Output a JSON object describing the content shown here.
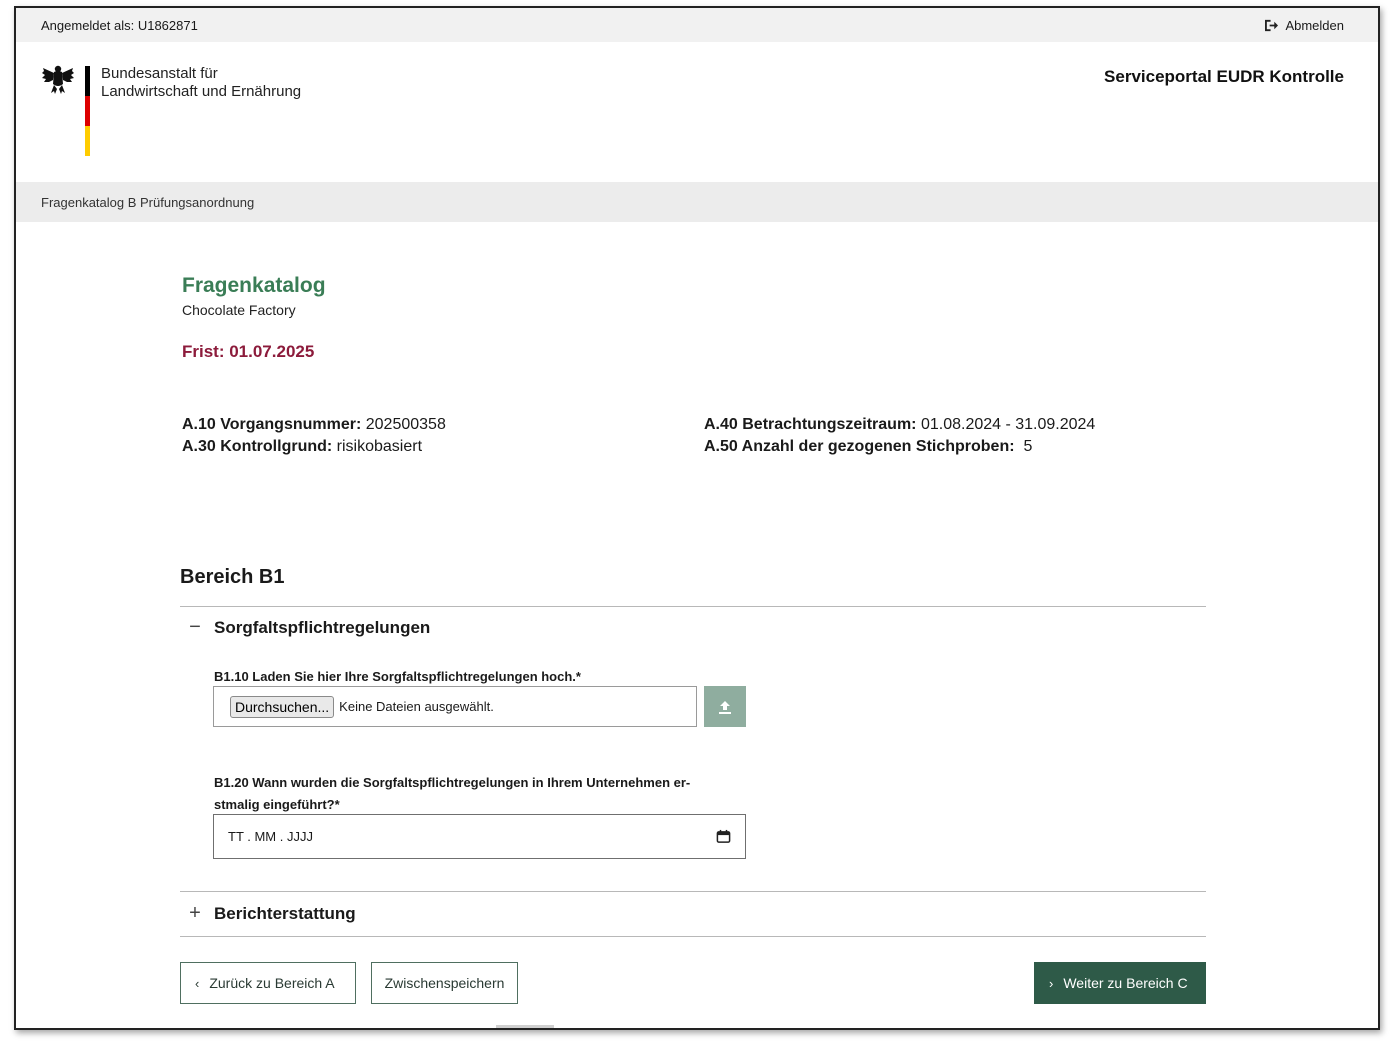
{
  "topbar": {
    "logged_in_as": "Angemeldet als: U1862871",
    "logout_label": "Abmelden"
  },
  "header": {
    "org_line1": "Bundesanstalt für",
    "org_line2": "Landwirtschaft und Ernährung",
    "portal_title": "Serviceportal EUDR Kontrolle"
  },
  "breadcrumb": "Fragenkatalog B Prüfungsanordnung",
  "page": {
    "title": "Fragenkatalog",
    "subtitle": "Chocolate Factory",
    "deadline": "Frist: 01.07.2025"
  },
  "meta": {
    "a10_label": "A.10 Vorgangsnummer:",
    "a10_value": "202500358",
    "a30_label": "A.30 Kontrollgrund:",
    "a30_value": "risikobasiert",
    "a40_label": "A.40 Betrachtungszeitraum:",
    "a40_value": "01.08.2024 - 31.09.2024",
    "a50_label": "A.50 Anzahl der gezogenen Stichproben:",
    "a50_value": "5"
  },
  "section": {
    "title": "Bereich B1",
    "accordion1": {
      "sign": "−",
      "label": "Sorgfaltspflichtregelungen",
      "expanded": true
    },
    "accordion2": {
      "sign": "+",
      "label": "Berichterstattung",
      "expanded": false
    }
  },
  "questions": {
    "b110_label": "B1.10 Laden Sie hier Ihre Sorgfaltspflichtregelungen hoch.*",
    "browse_label": "Durchsuchen...",
    "no_file_label": "Keine Dateien ausgewählt.",
    "b120_label_line1": "B1.20 Wann wurden die Sorgfaltspflichtregelungen in Ihrem Unternehmen er-",
    "b120_label_line2": "stmalig eingeführt?*",
    "date_placeholder": "TT . MM . JJJJ"
  },
  "buttons": {
    "back": "Zurück zu Bereich A",
    "save": "Zwischenspeichern",
    "next": "Weiter zu Bereich C"
  },
  "colors": {
    "accent_green": "#3a7d56",
    "deadline_red": "#8c1b3b",
    "primary_button": "#2e5a48",
    "upload_button": "#8fad9f"
  }
}
